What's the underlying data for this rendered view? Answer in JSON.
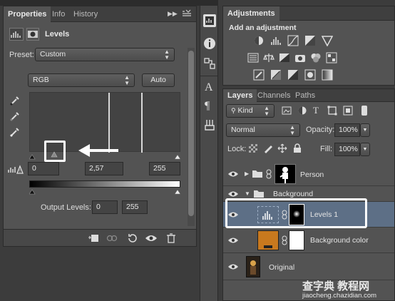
{
  "properties": {
    "tabs": [
      "Properties",
      "Info",
      "History"
    ],
    "panel_title": "Levels",
    "preset_label": "Preset:",
    "preset_value": "Custom",
    "channel_value": "RGB",
    "auto_label": "Auto",
    "input_black": "0",
    "input_mid": "2,57",
    "input_white": "255",
    "output_label": "Output Levels:",
    "output_black": "0",
    "output_white": "255"
  },
  "adjustments": {
    "tab": "Adjustments",
    "heading": "Add an adjustment"
  },
  "layers": {
    "tabs": [
      "Layers",
      "Channels",
      "Paths"
    ],
    "kind_value": "Kind",
    "blend_mode": "Normal",
    "opacity_label": "Opacity:",
    "opacity_value": "100%",
    "lock_label": "Lock:",
    "fill_label": "Fill:",
    "fill_value": "100%",
    "rows": [
      {
        "name": "Person"
      },
      {
        "name": "Background"
      },
      {
        "name": "Levels 1"
      },
      {
        "name": "Background color"
      },
      {
        "name": "Original"
      }
    ]
  },
  "watermark": {
    "line1": "查字典 教程网",
    "line2": "jiaocheng.chazidian.com"
  },
  "colors": {
    "panel_bg": "#535353",
    "selected_layer": "#5d6f86",
    "accent_orange": "#c8791e"
  }
}
